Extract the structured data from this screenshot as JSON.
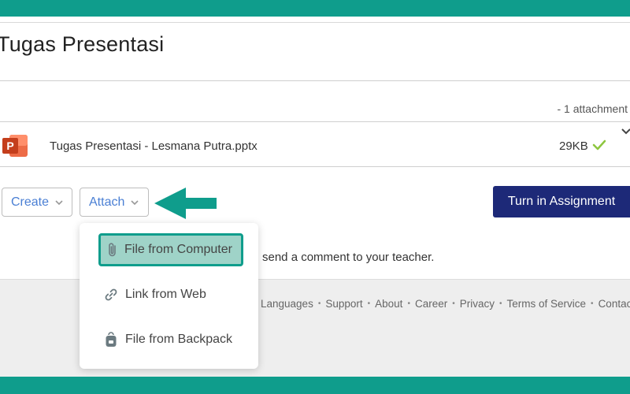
{
  "assignment": {
    "title": "Tugas Presentasi",
    "attachment_count": "- 1 attachment"
  },
  "file": {
    "name": "Tugas Presentasi - Lesmana Putra.pptx",
    "size": "29KB",
    "icon_letter": "P"
  },
  "actions": {
    "create_label": "Create",
    "attach_label": "Attach",
    "turn_in_label": "Turn in Assignment"
  },
  "attach_menu": {
    "items": [
      {
        "label": "File from Computer"
      },
      {
        "label": "Link from Web"
      },
      {
        "label": "File from Backpack"
      }
    ]
  },
  "comment": {
    "text": "send a comment to your teacher."
  },
  "footer": {
    "links": [
      "Languages",
      "Support",
      "About",
      "Career",
      "Privacy",
      "Terms of Service",
      "Contact"
    ]
  },
  "colors": {
    "brand_teal": "#0f9d8c",
    "turn_in_navy": "#1d2978",
    "link_blue": "#4a7fd4",
    "check_green": "#8dc63f",
    "ppt_orange": "#d04a23"
  }
}
